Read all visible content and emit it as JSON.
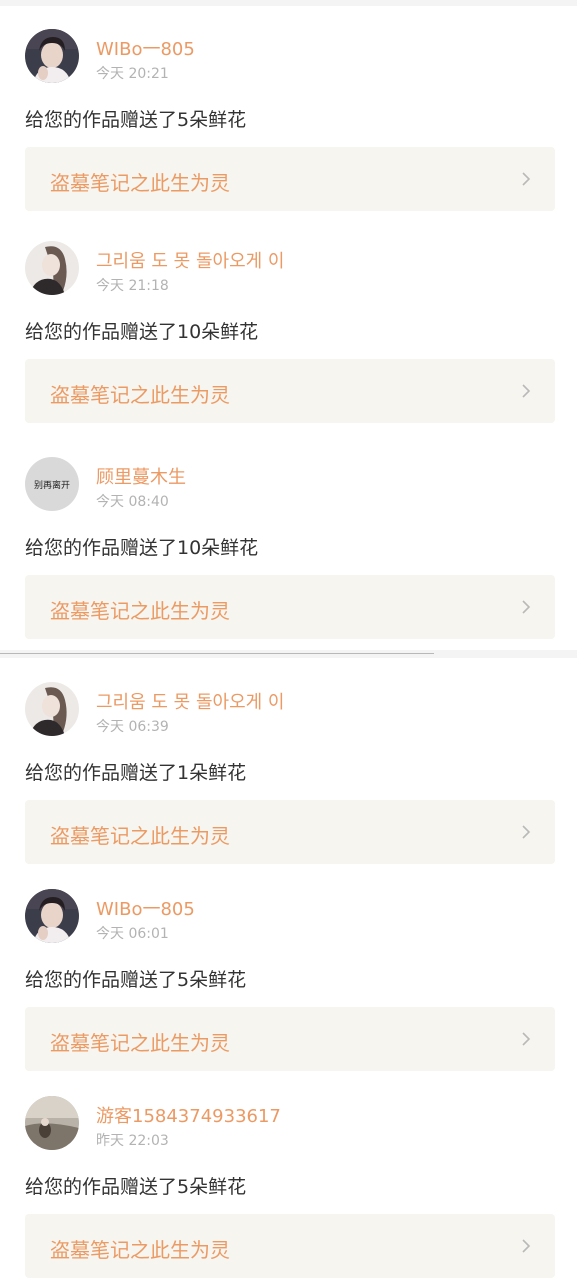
{
  "notifications": [
    {
      "username": "WIBo一805",
      "time": "今天 20:21",
      "message": "给您的作品赠送了5朵鲜花",
      "work_title": "盗墓笔记之此生为灵",
      "avatar": "portrait-young-man"
    },
    {
      "username": "그리움 도 못 돌아오게 이",
      "time": "今天 21:18",
      "message": "给您的作品赠送了10朵鲜花",
      "work_title": "盗墓笔记之此生为灵",
      "avatar": "portrait-long-hair"
    },
    {
      "username": "顾里蔓木生",
      "time": "今天 08:40",
      "message": "给您的作品赠送了10朵鲜花",
      "work_title": "盗墓笔记之此生为灵",
      "avatar": "calligraphy",
      "avatar_text": "别再离开"
    },
    {
      "username": "그리움 도 못 돌아오게 이",
      "time": "今天 06:39",
      "message": "给您的作品赠送了1朵鲜花",
      "work_title": "盗墓笔记之此生为灵",
      "avatar": "portrait-long-hair"
    },
    {
      "username": "WIBo一805",
      "time": "今天 06:01",
      "message": "给您的作品赠送了5朵鲜花",
      "work_title": "盗墓笔记之此生为灵",
      "avatar": "portrait-young-man"
    },
    {
      "username": "游客1584374933617",
      "time": "昨天 22:03",
      "message": "给您的作品赠送了5朵鲜花",
      "work_title": "盗墓笔记之此生为灵",
      "avatar": "landscape-scene"
    }
  ],
  "colors": {
    "accent": "#ec9a64",
    "muted": "#b3b3b3",
    "text": "#333333",
    "link_bg": "#f6f5ef"
  },
  "icons": {
    "chevron": "chevron-right-icon"
  }
}
